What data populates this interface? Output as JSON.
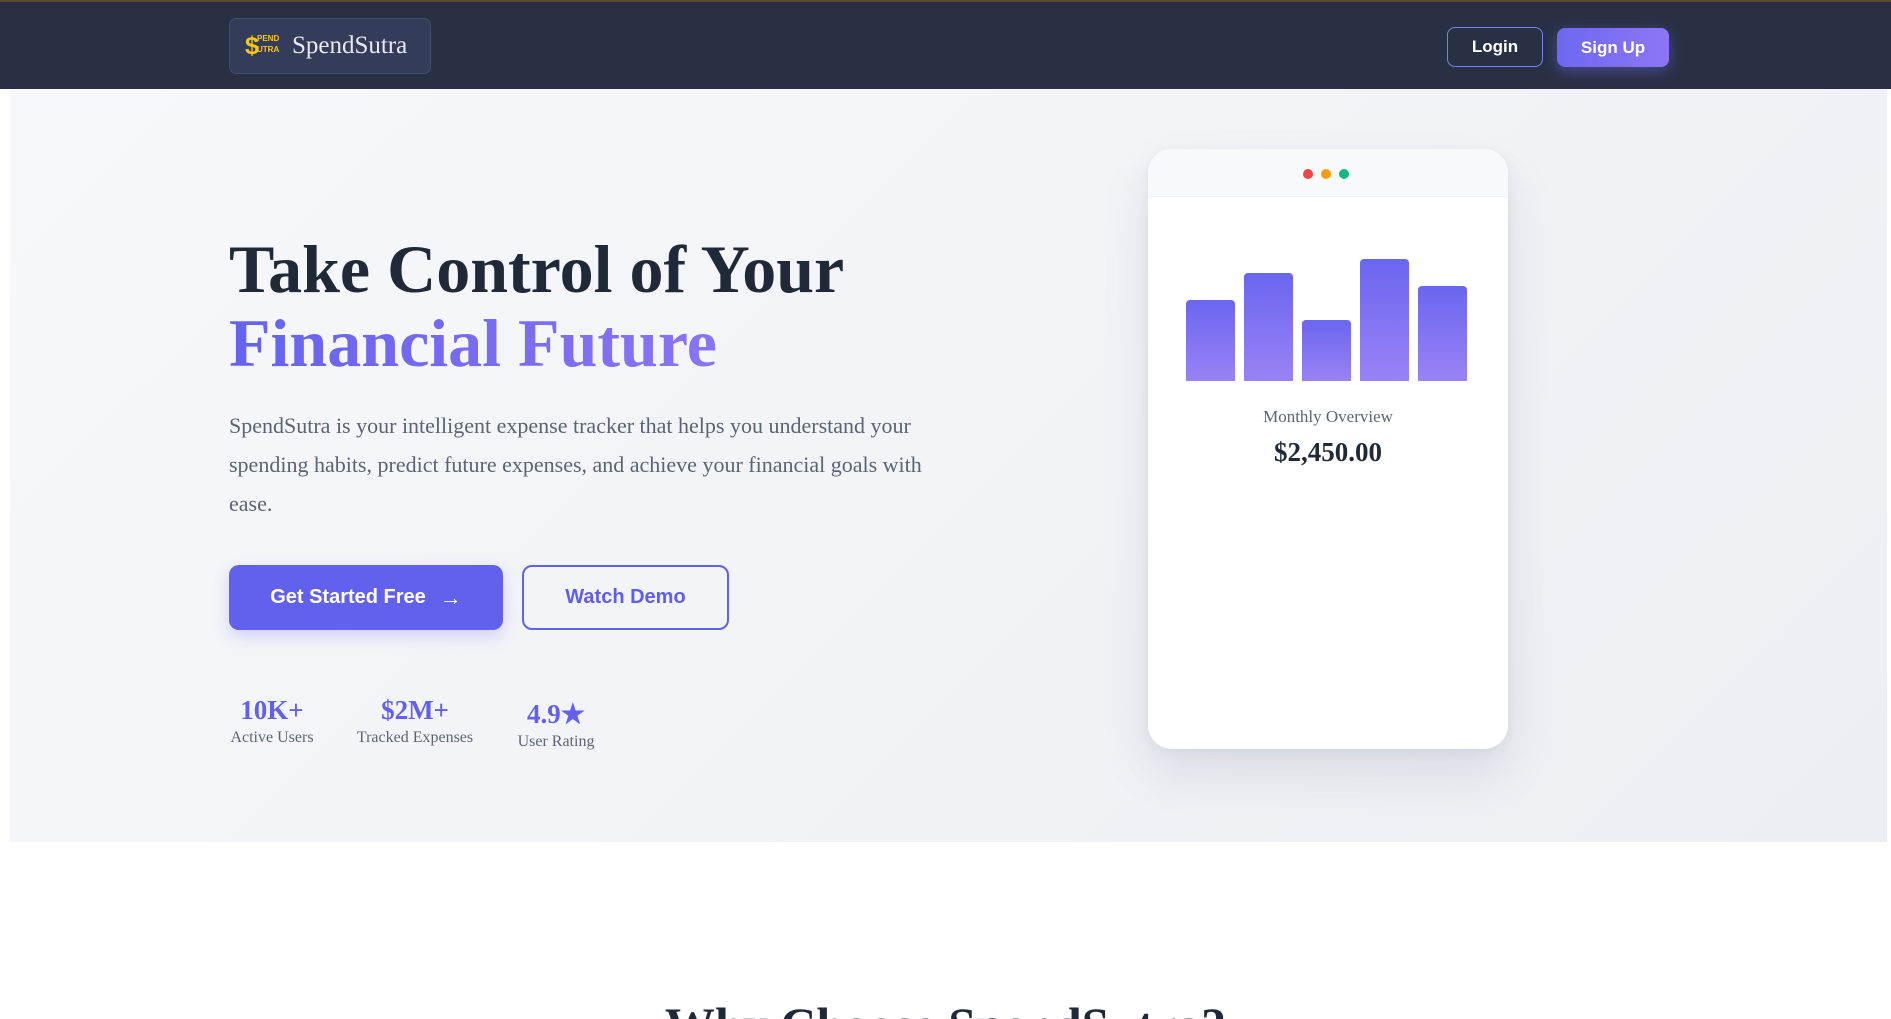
{
  "nav": {
    "brand_logo_big": "$",
    "brand_logo_top": "PEND",
    "brand_logo_bottom": "UTRA",
    "brand_name": "SpendSutra",
    "login_label": "Login",
    "signup_label": "Sign Up"
  },
  "hero": {
    "title_line1": "Take Control of Your",
    "title_line2": "Financial Future",
    "description": "SpendSutra is your intelligent expense tracker that helps you understand your spending habits, predict future expenses, and achieve your financial goals with ease.",
    "cta_primary": "Get Started Free",
    "cta_primary_icon": "arrow-right-icon",
    "cta_secondary": "Watch Demo",
    "stats": [
      {
        "value": "10K+",
        "label": "Active Users"
      },
      {
        "value": "$2M+",
        "label": "Tracked Expenses"
      },
      {
        "value": "4.9★",
        "label": "User Rating"
      }
    ]
  },
  "preview_card": {
    "window_dots": [
      "#ef4444",
      "#f59e0b",
      "#10b981"
    ],
    "bar_levels": [
      0.6,
      0.8,
      0.45,
      0.9,
      0.7
    ],
    "label": "Monthly Overview",
    "value": "$2,450.00"
  },
  "section": {
    "title": "Why Choose SpendSutra?"
  },
  "colors": {
    "nav_bg": "#283144",
    "accent": "#6261ee",
    "accent_light": "#9b7cf6",
    "text_dark": "#1f2937",
    "text_muted": "#5b6474"
  }
}
